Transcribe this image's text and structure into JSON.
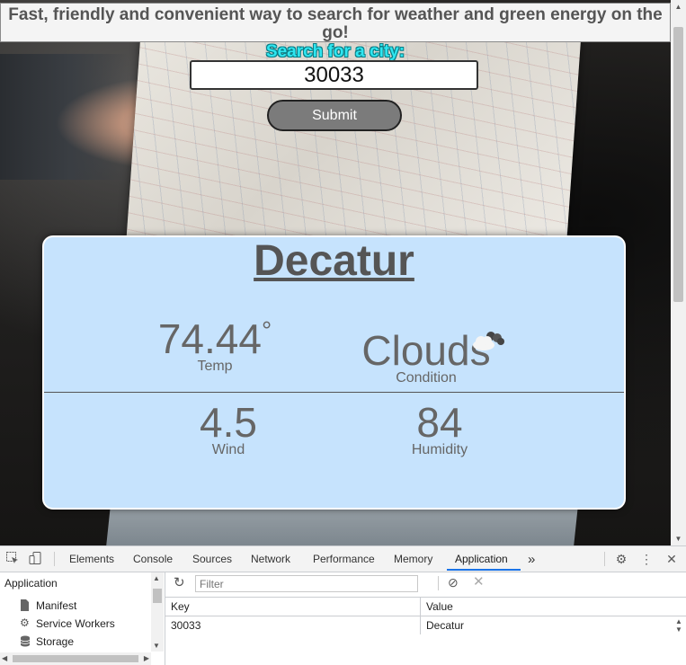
{
  "page": {
    "header_text": "Fast, friendly and convenient way to search for weather and green energy on the go!",
    "search_label": "Search for a city:",
    "search_value": "30033",
    "submit_label": "Submit"
  },
  "weather": {
    "city": "Decatur",
    "temp_value": "74.44",
    "temp_degree": "°",
    "temp_label": "Temp",
    "condition_value": "Clouds",
    "condition_label": "Condition",
    "condition_icon": "clouds-icon",
    "wind_value": "4.5",
    "wind_label": "Wind",
    "humidity_value": "84",
    "humidity_label": "Humidity"
  },
  "devtools": {
    "tabs": [
      "Elements",
      "Console",
      "Sources",
      "Network",
      "Performance",
      "Memory",
      "Application"
    ],
    "active_tab": "Application",
    "more_tabs": "»",
    "sidebar": {
      "header": "Application",
      "items": [
        "Manifest",
        "Service Workers",
        "Storage"
      ]
    },
    "filter_placeholder": "Filter",
    "table": {
      "headers": [
        "Key",
        "Value"
      ],
      "rows": [
        [
          "30033",
          "Decatur"
        ]
      ]
    }
  },
  "colors": {
    "card_bg": "#c6e3fd",
    "search_label": "#2fe6f0",
    "submit_bg": "#7b7b7b",
    "active_tab_underline": "#1a73e8"
  }
}
